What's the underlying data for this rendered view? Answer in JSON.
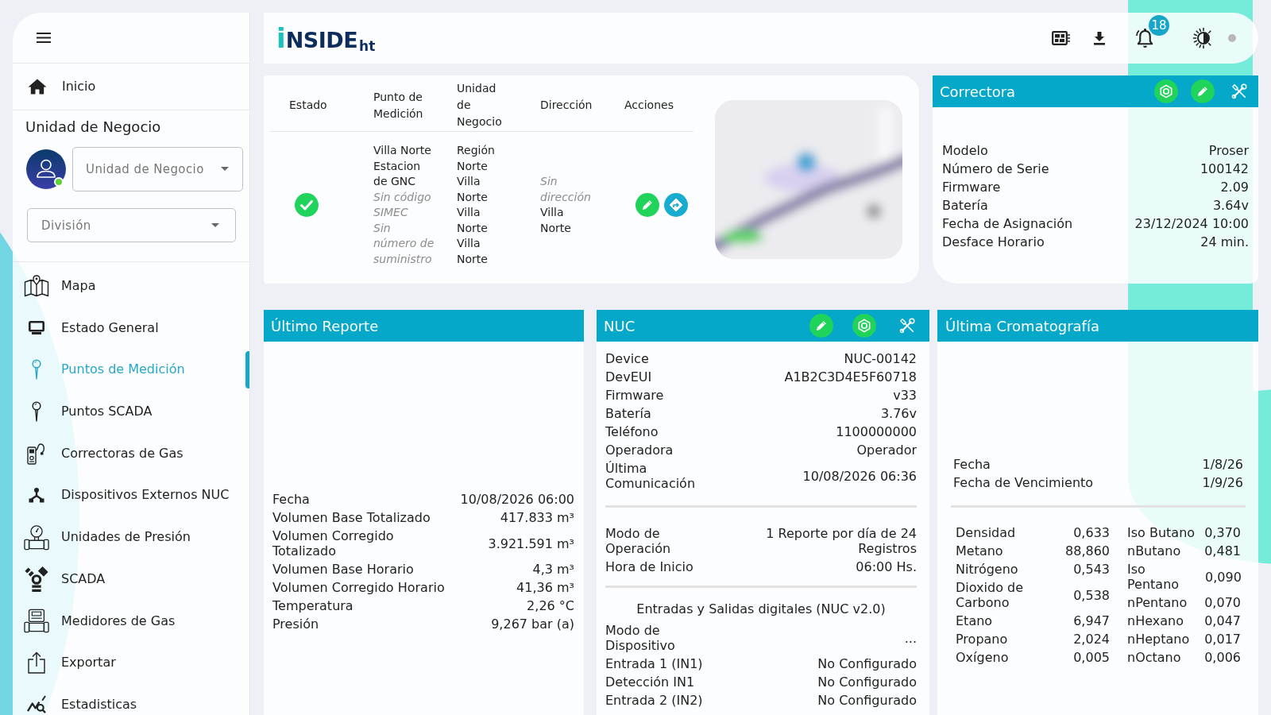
{
  "sidebar": {
    "home": {
      "label": "Inicio"
    },
    "section_title": "Unidad de Negocio",
    "user": {
      "online": true
    },
    "business_unit_select": {
      "placeholder": "Unidad de Negocio"
    },
    "division_select": {
      "placeholder": "División"
    },
    "nav_items": [
      {
        "label": "Mapa",
        "selected": false
      },
      {
        "label": "Estado General",
        "selected": false
      },
      {
        "label": "Puntos de Medición",
        "selected": true
      },
      {
        "label": "Puntos SCADA",
        "selected": false
      },
      {
        "label": "Correctoras de Gas",
        "selected": false
      },
      {
        "label": "Dispositivos Externos NUC",
        "selected": false
      },
      {
        "label": "Unidades de Presión",
        "selected": false
      },
      {
        "label": "SCADA",
        "selected": false
      },
      {
        "label": "Medidores de Gas",
        "selected": false
      },
      {
        "label": "Exportar",
        "selected": false
      },
      {
        "label": "Estadisticas",
        "selected": false
      }
    ]
  },
  "header": {
    "logo": {
      "initial": "i",
      "name": "NSIDE",
      "suffix": "ht"
    },
    "notifications": {
      "count": "18"
    }
  },
  "points_table": {
    "columns": [
      "Estado",
      "Punto de Medición",
      "Unidad de Negocio",
      "Dirección",
      "Acciones"
    ],
    "rows": [
      {
        "ok": true,
        "measurement_point": [
          {
            "text": "Villa Norte Estacion de GNC",
            "missing": false
          },
          {
            "text": "Sin código SIMEC",
            "missing": true
          },
          {
            "text": "Sin número de suministro",
            "missing": true
          }
        ],
        "business_unit": [
          {
            "text": "Región Norte",
            "missing": false
          },
          {
            "text": "Villa Norte",
            "missing": false
          },
          {
            "text": "Villa Norte",
            "missing": false
          },
          {
            "text": "Villa Norte",
            "missing": false
          }
        ],
        "address": [
          {
            "text": "Sin dirección",
            "missing": true
          },
          {
            "text": "Villa Norte",
            "missing": false
          }
        ]
      }
    ]
  },
  "correctora": {
    "title": "Correctora",
    "fields": [
      {
        "label": "Modelo",
        "value": "Proser"
      },
      {
        "label": "Número de Serie",
        "value": "100142"
      },
      {
        "label": "Firmware",
        "value": "2.09"
      },
      {
        "label": "Batería",
        "value": "3.64v"
      },
      {
        "label": "Fecha de Asignación",
        "value": "23/12/2024 10:00"
      },
      {
        "label": "Desface Horario",
        "value": "24 min."
      }
    ]
  },
  "last_report": {
    "title": "Último Reporte",
    "fields": [
      {
        "label": "Fecha",
        "value": "10/08/2026 06:00"
      },
      {
        "label": "Volumen Base Totalizado",
        "value": "417.833 m³"
      },
      {
        "label": "Volumen Corregido Totalizado",
        "value": "3.921.591 m³"
      },
      {
        "label": "Volumen Base Horario",
        "value": "4,3 m³"
      },
      {
        "label": "Volumen Corregido Horario",
        "value": "41,36 m³"
      },
      {
        "label": "Temperatura",
        "value": "2,26 °C"
      },
      {
        "label": "Presión",
        "value": "9,267 bar (a)"
      }
    ]
  },
  "nuc": {
    "title": "NUC",
    "device_fields": [
      {
        "label": "Device",
        "value": "NUC-00142"
      },
      {
        "label": "DevEUI",
        "value": "A1B2C3D4E5F60718"
      },
      {
        "label": "Firmware",
        "value": "v33"
      },
      {
        "label": "Batería",
        "value": "3.76v"
      },
      {
        "label": "Teléfono",
        "value": "1100000000"
      },
      {
        "label": "Operadora",
        "value": "Operador"
      },
      {
        "label": "Última Comunicación",
        "value": "10/08/2026 06:36"
      }
    ],
    "mode_fields": [
      {
        "label": "Modo de Operación",
        "value": "1 Reporte por día de 24 Registros"
      },
      {
        "label": "Hora de Inicio",
        "value": "06:00 Hs."
      }
    ],
    "io_title": "Entradas y Salidas digitales (NUC v2.0)",
    "io_fields": [
      {
        "label": "Modo de Dispositivo",
        "value": "..."
      },
      {
        "label": "Entrada 1 (IN1)",
        "value": "No Configurado"
      },
      {
        "label": "Detección IN1",
        "value": "No Configurado"
      },
      {
        "label": "Entrada 2 (IN2)",
        "value": "No Configurado"
      }
    ]
  },
  "chromatography": {
    "title": "Última Cromatografía",
    "date_fields": [
      {
        "label": "Fecha",
        "value": "1/8/26"
      },
      {
        "label": "Fecha de Vencimiento",
        "value": "1/9/26"
      }
    ],
    "components_left": [
      {
        "label": "Densidad",
        "value": "0,633"
      },
      {
        "label": "Metano",
        "value": "88,860"
      },
      {
        "label": "Nitrógeno",
        "value": "0,543"
      },
      {
        "label": "Dioxido de Carbono",
        "value": "0,538"
      },
      {
        "label": "Etano",
        "value": "6,947"
      },
      {
        "label": "Propano",
        "value": "2,024"
      },
      {
        "label": "Oxígeno",
        "value": "0,005"
      }
    ],
    "components_right": [
      {
        "label": "Iso Butano",
        "value": "0,370"
      },
      {
        "label": "nButano",
        "value": "0,481"
      },
      {
        "label": "Iso Pentano",
        "value": "0,090"
      },
      {
        "label": "nPentano",
        "value": "0,070"
      },
      {
        "label": "nHexano",
        "value": "0,047"
      },
      {
        "label": "nHeptano",
        "value": "0,017"
      },
      {
        "label": "nOctano",
        "value": "0,006"
      }
    ]
  }
}
